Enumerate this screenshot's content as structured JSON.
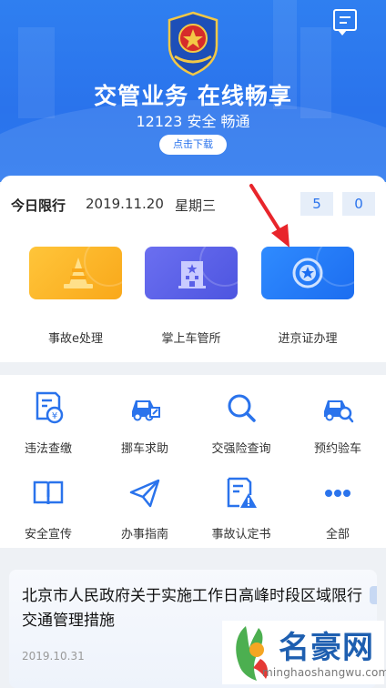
{
  "banner": {
    "title": "交管业务 在线畅享",
    "subtitle": "12123 安全 畅通",
    "download_label": "点击下载",
    "icons": [
      "police-emblem-icon",
      "message-icon"
    ]
  },
  "traffic_limit": {
    "label": "今日限行",
    "date": "2019.11.20",
    "weekday": "星期三",
    "numbers": [
      "5",
      "0"
    ]
  },
  "quick_tiles": [
    {
      "label": "事故e处理",
      "icon": "traffic-cone-icon",
      "color": "#ffb327"
    },
    {
      "label": "掌上车管所",
      "icon": "building-icon",
      "color": "#5a60e8"
    },
    {
      "label": "进京证办理",
      "icon": "star-badge-icon",
      "color": "#2a7df5"
    }
  ],
  "services": [
    {
      "label": "违法查缴",
      "icon": "fine-document-icon"
    },
    {
      "label": "挪车求助",
      "icon": "car-edit-icon"
    },
    {
      "label": "交强险查询",
      "icon": "search-icon"
    },
    {
      "label": "预约验车",
      "icon": "car-search-icon"
    },
    {
      "label": "安全宣传",
      "icon": "book-icon"
    },
    {
      "label": "办事指南",
      "icon": "paper-plane-icon"
    },
    {
      "label": "事故认定书",
      "icon": "warning-document-icon"
    },
    {
      "label": "全部",
      "icon": "more-dots-icon"
    }
  ],
  "news": {
    "title": "北京市人民政府关于实施工作日高峰时段区域限行交通管理措施",
    "date": "2019.10.31"
  },
  "watermark": {
    "text": "名豪网",
    "url": "minghaoshangwu.com"
  },
  "colors": {
    "primary": "#2a73ec",
    "accent_blue": "#2a7df5",
    "orange": "#ffb327",
    "purple": "#5a60e8",
    "arrow_red": "#e8252b"
  }
}
